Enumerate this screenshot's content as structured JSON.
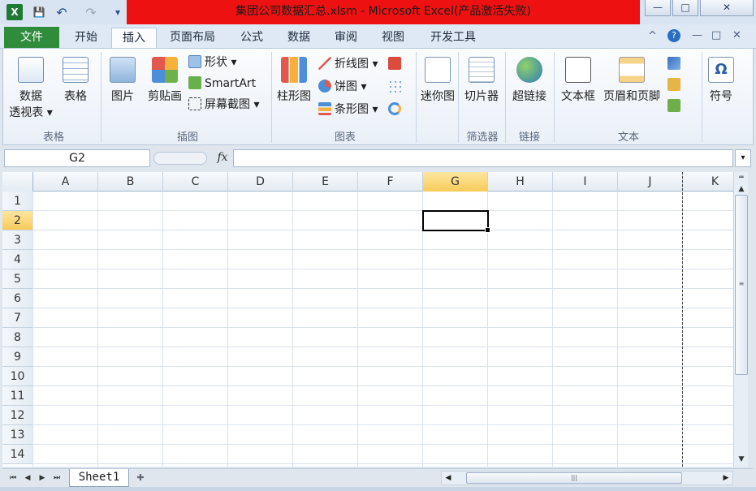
{
  "window": {
    "title": "集团公司数据汇总.xlsm - Microsoft Excel(产品激活失败)",
    "controls": [
      "—",
      "□",
      "✕"
    ]
  },
  "quick_access": {
    "app_icon": "X",
    "save": "💾",
    "undo": "↶",
    "redo": "↷",
    "customize": "▾"
  },
  "tabs": [
    {
      "label": "文件"
    },
    {
      "label": "开始"
    },
    {
      "label": "插入"
    },
    {
      "label": "页面布局"
    },
    {
      "label": "公式"
    },
    {
      "label": "数据"
    },
    {
      "label": "审阅"
    },
    {
      "label": "视图"
    },
    {
      "label": "开发工具"
    }
  ],
  "ribbon_controls": {
    "minimize": "^",
    "help": "?",
    "win_min": "—",
    "win_restore": "□",
    "win_close": "✕"
  },
  "ribbon": {
    "groups": [
      {
        "label": "表格"
      },
      {
        "label": "插图"
      },
      {
        "label": "图表"
      },
      {
        "label": "筛选器"
      },
      {
        "label": "链接"
      },
      {
        "label": "文本"
      }
    ],
    "pivot": {
      "line1": "数据",
      "line2": "透视表 ▾"
    },
    "table": "表格",
    "picture": "图片",
    "clipart": "剪贴画",
    "shapes": "形状 ▾",
    "smartart": "SmartArt",
    "screenshot": "屏幕截图 ▾",
    "column_chart": "柱形图",
    "line_chart": "折线图 ▾",
    "pie_chart": "饼图 ▾",
    "bar_chart": "条形图 ▾",
    "sparkline": "迷你图",
    "slicer": "切片器",
    "hyperlink": "超链接",
    "textbox": "文本框",
    "header_footer": "页眉和页脚",
    "symbol": "符号"
  },
  "formula_bar": {
    "name_box": "G2",
    "fx": "fx",
    "formula": ""
  },
  "columns": [
    "A",
    "B",
    "C",
    "D",
    "E",
    "F",
    "G",
    "H",
    "I",
    "J",
    "K"
  ],
  "rows": [
    "1",
    "2",
    "3",
    "4",
    "5",
    "6",
    "7",
    "8",
    "9",
    "10",
    "11",
    "12",
    "13",
    "14"
  ],
  "active_cell": "G2",
  "sheet_tabs": [
    {
      "label": "Sheet1"
    }
  ],
  "colors": {
    "selected_header": "#f8cb59",
    "title_bar_red": "#ee1111",
    "file_tab": "#2f8c3b"
  }
}
